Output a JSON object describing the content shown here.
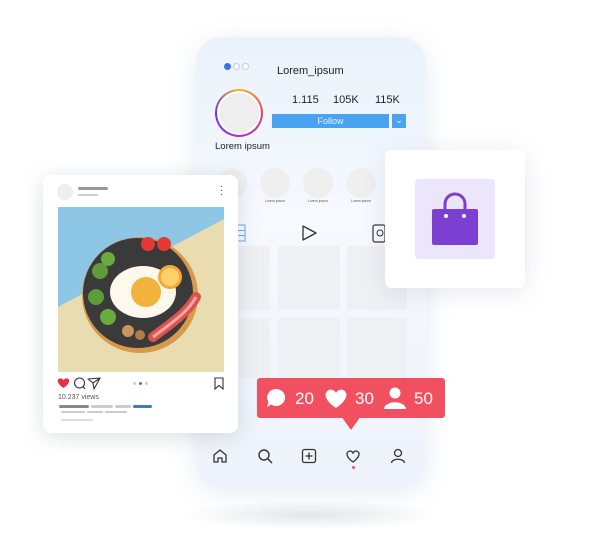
{
  "profile": {
    "username": "Lorem_ipsum",
    "name": "Lorem ipsum",
    "stats": [
      "1.115",
      "105K",
      "115K"
    ],
    "follow_label": "Follow",
    "dropdown_icon": "chevron-down-icon"
  },
  "stories": [
    {
      "label": ""
    },
    {
      "label": "Lorem ipsum"
    },
    {
      "label": "Lorem ipsum"
    },
    {
      "label": "Lorem ipsum"
    }
  ],
  "tabs": [
    "grid-icon",
    "play-icon",
    "tagged-icon"
  ],
  "bottom_nav": [
    "home-icon",
    "search-icon",
    "add-icon",
    "heart-icon",
    "profile-icon"
  ],
  "post": {
    "views": "10.237 views",
    "carousel_active": 1,
    "liked": true
  },
  "notification": {
    "comments": "20",
    "likes": "30",
    "followers": "50"
  },
  "colors": {
    "accent": "#4aa3f0",
    "notification": "#f0505f",
    "bag": "#7b3fd1",
    "like": "#e8303f"
  }
}
